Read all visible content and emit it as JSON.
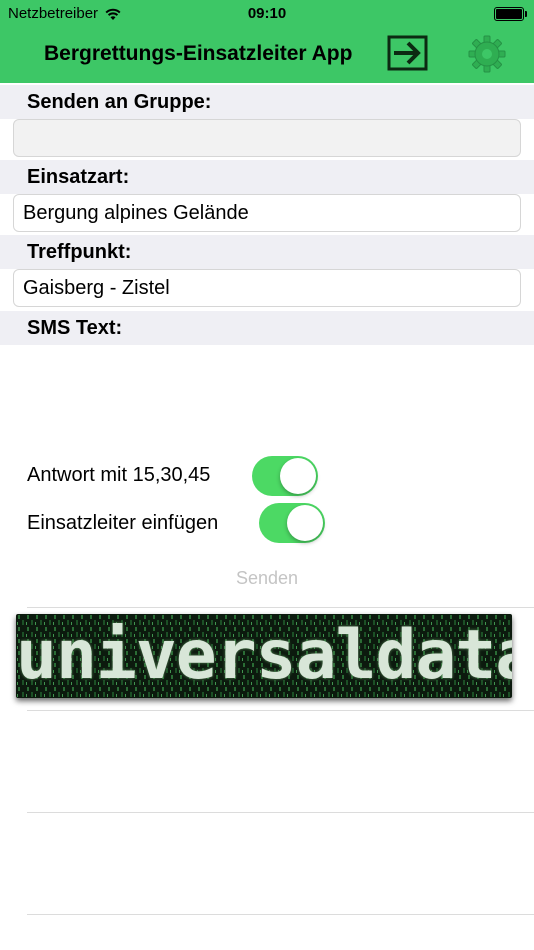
{
  "status_bar": {
    "carrier": "Netzbetreiber",
    "time": "09:10",
    "battery_level": 1.0
  },
  "header": {
    "title": "Bergrettungs-Einsatzleiter App",
    "background_color": "#3dc766",
    "exit_icon": "arrow-right-exit-icon",
    "settings_icon": "gear-icon"
  },
  "form": {
    "group_label": "Senden an Gruppe:",
    "group_value": "",
    "type_label": "Einsatzart:",
    "type_value": "Bergung alpines Gelände",
    "meeting_label": "Treffpunkt:",
    "meeting_value": "Gaisberg - Zistel",
    "sms_label": "SMS Text:",
    "sms_value": ""
  },
  "toggles": {
    "reply_label": "Antwort mit 15,30,45",
    "reply_on": true,
    "leader_label": "Einsatzleiter einfügen",
    "leader_on": true,
    "on_color": "#4cd964"
  },
  "actions": {
    "send_label": "Senden"
  },
  "logo": {
    "text": "universaldata"
  }
}
